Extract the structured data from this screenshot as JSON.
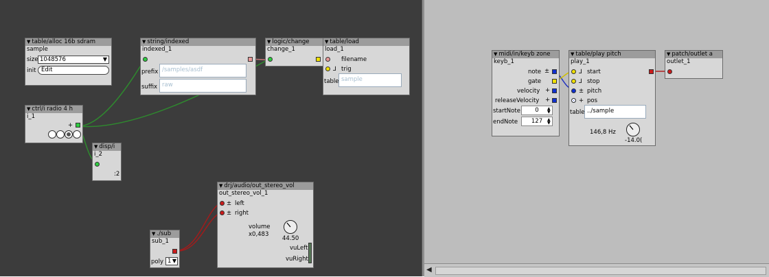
{
  "objects": {
    "alloc": {
      "type": "table/alloc 16b sdram",
      "name": "sample",
      "size_label": "size",
      "size_value": "1048576",
      "init_label": "init",
      "edit_label": "Edit"
    },
    "string": {
      "type": "string/indexed",
      "name": "indexed_1",
      "prefix_label": "prefix",
      "prefix_value": "/samples/asdf",
      "suffix_label": "suffix",
      "suffix_value": "raw"
    },
    "change": {
      "type": "logic/change",
      "name": "change_1"
    },
    "load": {
      "type": "table/load",
      "name": "load_1",
      "filename_label": "filename",
      "trig_label": "trig",
      "table_label": "table",
      "table_value": "sample"
    },
    "radio": {
      "type": "ctrl/i radio 4 h",
      "name": "i_1",
      "plus": "+"
    },
    "disp": {
      "type": "disp/i",
      "name": "i_2",
      "value": ":2"
    },
    "sub": {
      "type": "./sub",
      "name": "sub_1",
      "poly_label": "poly",
      "poly_value": "1"
    },
    "out": {
      "type": "drj/audio/out_stereo_vol",
      "name": "out_stereo_vol_1",
      "left_label": "left",
      "right_label": "right",
      "pm": "±",
      "volume_label": "volume",
      "volume_mult": "x0,483",
      "volume_value": "44.50",
      "vuleft_label": "vuLeft",
      "vuright_label": "vuRight"
    },
    "keyb": {
      "type": "midi/in/keyb zone",
      "name": "keyb_1",
      "note_label": "note",
      "gate_label": "gate",
      "velocity_label": "velocity",
      "release_label": "releaseVelocity",
      "startnote_label": "startNote",
      "startnote_value": "0",
      "endnote_label": "endNote",
      "endnote_value": "127",
      "pm": "±",
      "plus": "+"
    },
    "play": {
      "type": "table/play pitch",
      "name": "play_1",
      "start_label": "start",
      "stop_label": "stop",
      "pitch_label": "pitch",
      "pos_label": "pos",
      "table_label": "table",
      "table_value": "../sample",
      "freq": "146,8 Hz",
      "knob_value": "-14.0(",
      "pm": "±",
      "plus": "+"
    },
    "outlet": {
      "type": "patch/outlet a",
      "name": "outlet_1"
    }
  },
  "colors": {
    "bool": "#2ecc40",
    "string": "#e89898",
    "int": "#f0e000",
    "audio": "#cc1b1b",
    "frac": "#1030d0",
    "wire_green": "#2e8b2e",
    "wire_red": "#b02020",
    "wire_blue": "#2030c0"
  }
}
